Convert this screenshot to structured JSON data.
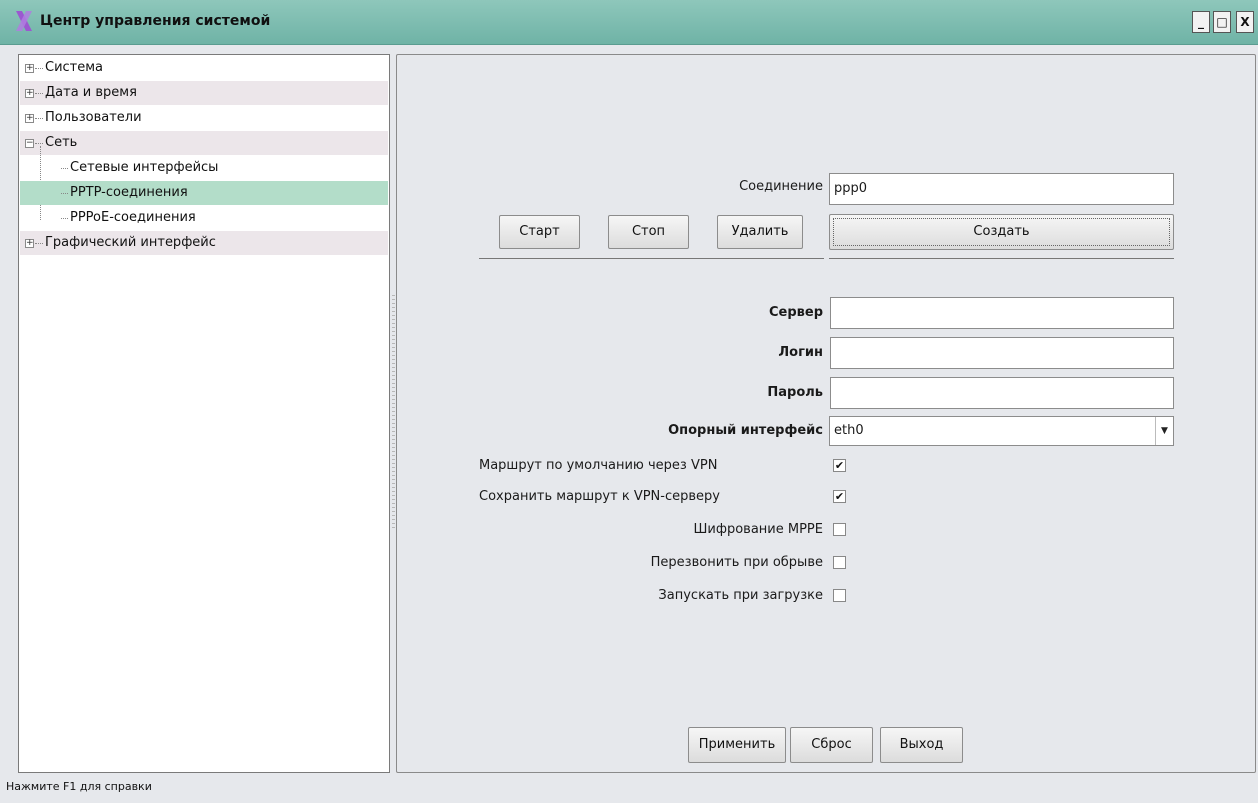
{
  "window": {
    "title": "Центр управления системой",
    "minimize": "_",
    "maximize": "□",
    "close": "X"
  },
  "tree": [
    {
      "label": "Система",
      "expander": "+"
    },
    {
      "label": "Дата и время",
      "expander": "+"
    },
    {
      "label": "Пользователи",
      "expander": "+"
    },
    {
      "label": "Сеть",
      "expander": "−"
    },
    {
      "label": "Сетевые интерфейсы"
    },
    {
      "label": "PPTP-соединения"
    },
    {
      "label": "PPPoE-соединения"
    },
    {
      "label": "Графический интерфейс",
      "expander": "+"
    }
  ],
  "form": {
    "connection_label": "Соединение",
    "connection_value": "ppp0",
    "start": "Старт",
    "stop": "Стоп",
    "delete": "Удалить",
    "create": "Создать",
    "server_label": "Сервер",
    "server_value": "",
    "login_label": "Логин",
    "login_value": "",
    "password_label": "Пароль",
    "password_value": "",
    "iface_label": "Опорный интерфейс",
    "iface_value": "eth0",
    "opts": [
      {
        "label": "Маршрут по умолчанию через VPN",
        "checked": true
      },
      {
        "label": "Сохранить маршрут к VPN-серверу",
        "checked": true
      },
      {
        "label": "Шифрование MPPE",
        "checked": false
      },
      {
        "label": "Перезвонить при обрыве",
        "checked": false
      },
      {
        "label": "Запускать при загрузке",
        "checked": false
      }
    ],
    "apply": "Применить",
    "reset": "Сброс",
    "exit": "Выход"
  },
  "status": "Нажмите F1 для справки",
  "colors": {
    "titlebar": "#7dbdb1",
    "selected_row": "#b3ddc9",
    "shaded_row": "#ece6ea",
    "logo": "#9b59d0"
  }
}
